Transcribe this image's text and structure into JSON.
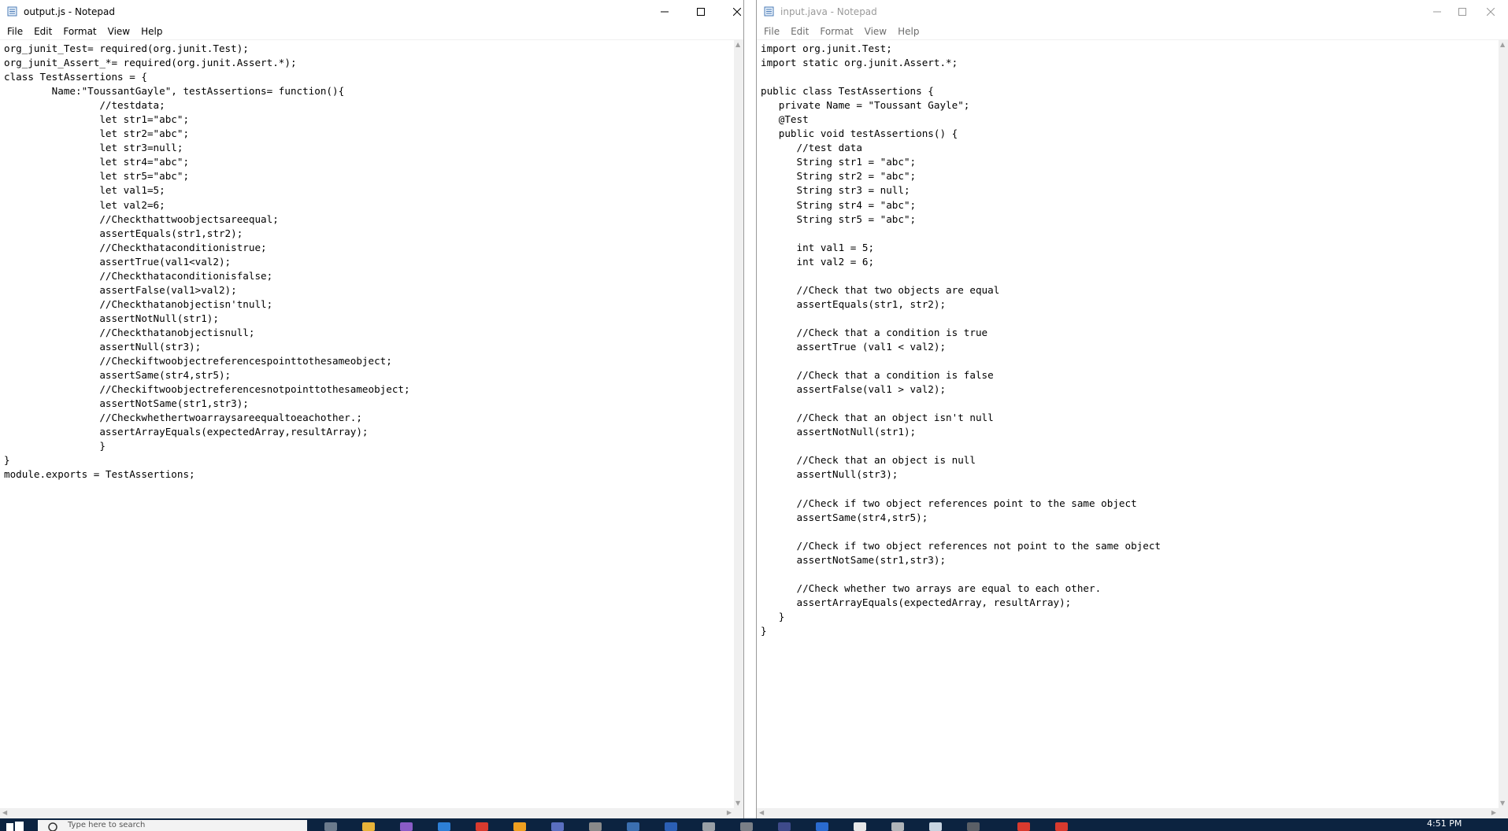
{
  "left_window": {
    "title": "output.js - Notepad",
    "menu": [
      "File",
      "Edit",
      "Format",
      "View",
      "Help"
    ],
    "content": "org_junit_Test= required(org.junit.Test);\norg_junit_Assert_*= required(org.junit.Assert.*);\nclass TestAssertions = {\n        Name:\"ToussantGayle\", testAssertions= function(){\n                //testdata;\n                let str1=\"abc\";\n                let str2=\"abc\";\n                let str3=null;\n                let str4=\"abc\";\n                let str5=\"abc\";\n                let val1=5;\n                let val2=6;\n                //Checkthattwoobjectsareequal;\n                assertEquals(str1,str2);\n                //Checkthataconditionistrue;\n                assertTrue(val1<val2);\n                //Checkthataconditionisfalse;\n                assertFalse(val1>val2);\n                //Checkthatanobjectisn'tnull;\n                assertNotNull(str1);\n                //Checkthatanobjectisnull;\n                assertNull(str3);\n                //Checkiftwoobjectreferencespointtothesameobject;\n                assertSame(str4,str5);\n                //Checkiftwoobjectreferencesnotpointtothesameobject;\n                assertNotSame(str1,str3);\n                //Checkwhethertwoarraysareequaltoeachother.;\n                assertArrayEquals(expectedArray,resultArray);\n                }\n}\nmodule.exports = TestAssertions;"
  },
  "right_window": {
    "title": "input.java - Notepad",
    "menu": [
      "File",
      "Edit",
      "Format",
      "View",
      "Help"
    ],
    "content": "import org.junit.Test;\nimport static org.junit.Assert.*;\n\npublic class TestAssertions {\n   private Name = \"Toussant Gayle\";\n   @Test\n   public void testAssertions() {\n      //test data\n      String str1 = \"abc\";\n      String str2 = \"abc\";\n      String str3 = null;\n      String str4 = \"abc\";\n      String str5 = \"abc\";\n\n      int val1 = 5;\n      int val2 = 6;\n\n      //Check that two objects are equal\n      assertEquals(str1, str2);\n\n      //Check that a condition is true\n      assertTrue (val1 < val2);\n\n      //Check that a condition is false\n      assertFalse(val1 > val2);\n\n      //Check that an object isn't null\n      assertNotNull(str1);\n\n      //Check that an object is null\n      assertNull(str3);\n\n      //Check if two object references point to the same object\n      assertSame(str4,str5);\n\n      //Check if two object references not point to the same object\n      assertNotSame(str1,str3);\n\n      //Check whether two arrays are equal to each other.\n      assertArrayEquals(expectedArray, resultArray);\n   }\n}"
  },
  "taskbar": {
    "search_placeholder": "Type here to search",
    "clock": "4:51 PM"
  }
}
